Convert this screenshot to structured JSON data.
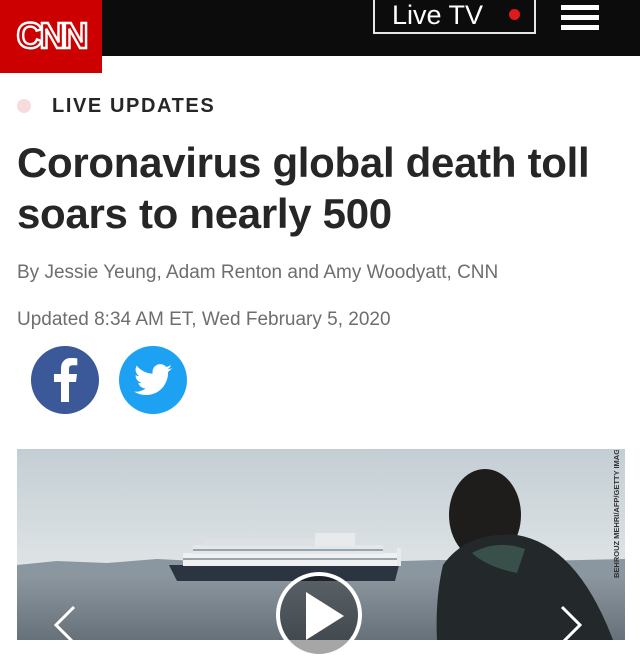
{
  "header": {
    "logo_text": "CNN",
    "live_tv_label": "Live TV",
    "menu_icon": "hamburger-menu-icon"
  },
  "article": {
    "badge": "LIVE UPDATES",
    "headline": "Coronavirus global death toll soars to nearly 500",
    "byline": "By Jessie Yeung, Adam Renton and Amy Woodyatt, CNN",
    "updated": "Updated 8:34 AM ET, Wed February 5, 2020"
  },
  "share": {
    "facebook_icon": "facebook-icon",
    "twitter_icon": "twitter-icon"
  },
  "media": {
    "credit": "BEHROUZ MEHRI/AFP/GETTY IMAGES",
    "play_icon": "play-icon",
    "prev_icon": "chevron-left-icon",
    "next_icon": "chevron-right-icon"
  },
  "colors": {
    "brand_red": "#cc0000",
    "topbar": "#0c0c0c",
    "facebook": "#3b5998",
    "twitter": "#1da1f2",
    "live_dot": "#e0191a"
  }
}
